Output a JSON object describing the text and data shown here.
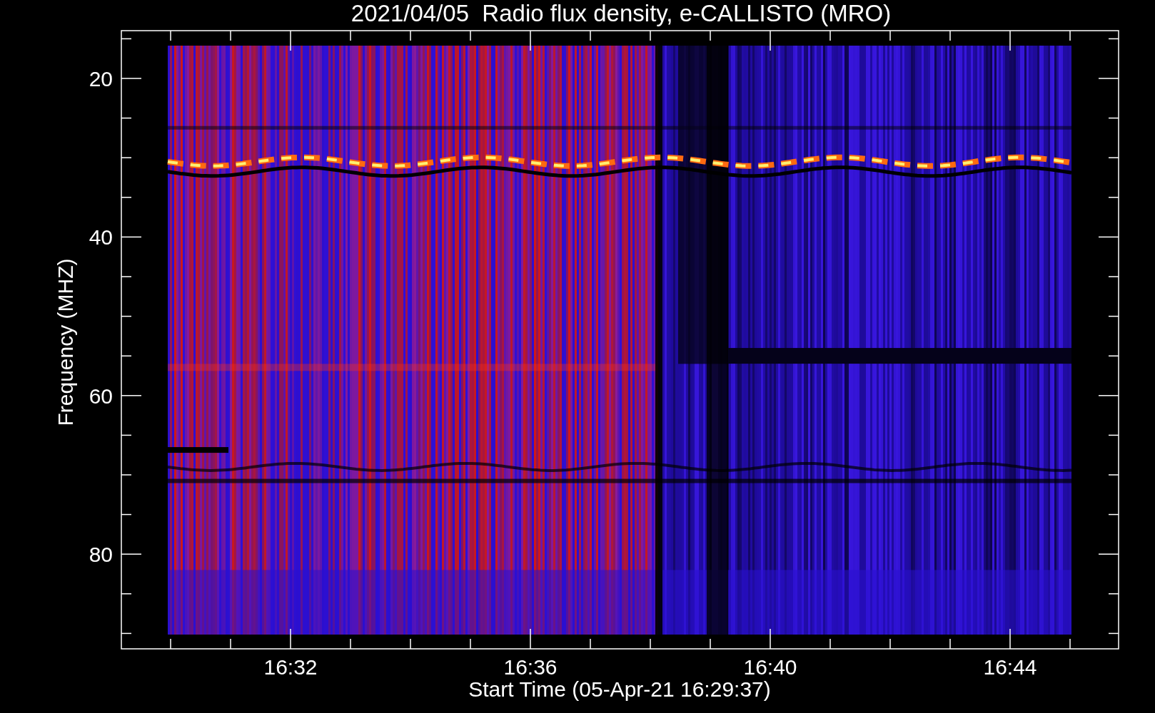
{
  "title": "2021/04/05  Radio flux density, e-CALLISTO (MRO)",
  "y_axis": {
    "label": "Frequency (MHZ)",
    "tick_labels": [
      "20",
      "40",
      "60",
      "80"
    ]
  },
  "x_axis": {
    "label": "Start Time (05-Apr-21 16:29:37)",
    "tick_labels": [
      "16:32",
      "16:36",
      "16:40",
      "16:44"
    ]
  }
}
